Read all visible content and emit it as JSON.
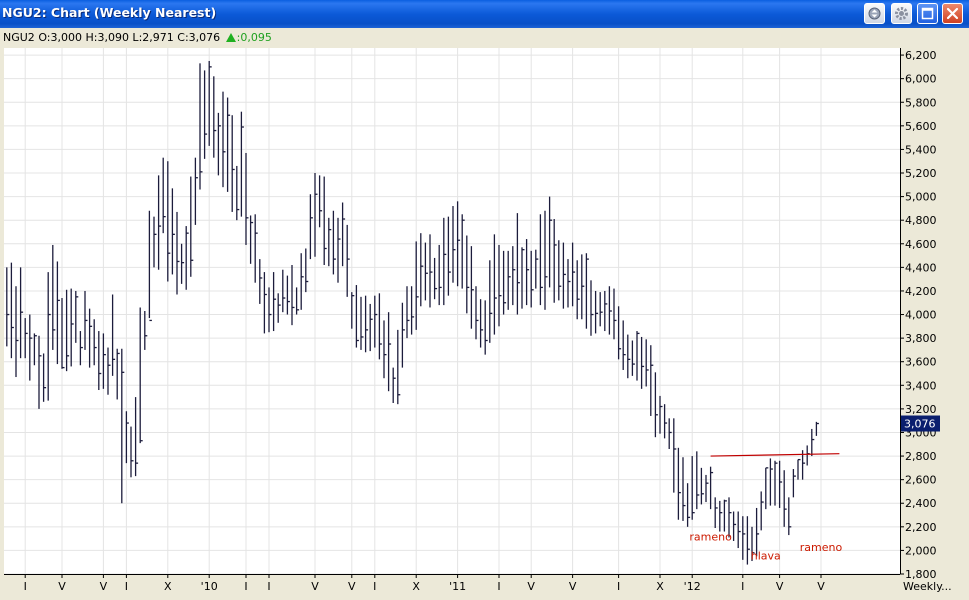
{
  "window": {
    "title": "NGU2: Chart (Weekly Nearest)",
    "buttons": [
      "scroll-icon",
      "gear-icon",
      "maximize-icon",
      "close-icon"
    ]
  },
  "quote": {
    "symbol": "NGU2",
    "ohlc": "O:3,000 H:3,090 L:2,971 C:3,076",
    "change": ":0,095",
    "change_color": "#20a020"
  },
  "colors": {
    "bars": "#1c1c3c",
    "neckline": "#c00000",
    "annotation": "#cc1a00",
    "last_price_bg": "#0a1e6e",
    "grid": "#e4e4e4"
  },
  "chart_data": {
    "type": "ohlc",
    "ylim": [
      1800,
      6260
    ],
    "y_ticks": [
      "6,200",
      "6,000",
      "5,800",
      "5,600",
      "5,400",
      "5,200",
      "5,000",
      "4,800",
      "4,600",
      "4,400",
      "4,200",
      "4,000",
      "3,800",
      "3,600",
      "3,400",
      "3,200",
      "3,000",
      "2,800",
      "2,600",
      "2,400",
      "2,200",
      "2,000",
      "1,800"
    ],
    "x_ticks": [
      "I",
      "V",
      "V",
      "I",
      "X",
      "'10",
      "I",
      "I",
      "V",
      "V",
      "I",
      "X",
      "'11",
      "I",
      "V",
      "V",
      "I",
      "X",
      "'12",
      "I",
      "V",
      "V"
    ],
    "x_tick_index": [
      4,
      12,
      21,
      26,
      35,
      44,
      52,
      57,
      67,
      75,
      80,
      89,
      98,
      107,
      114,
      123,
      133,
      142,
      149,
      160,
      168,
      177
    ],
    "period_label": "Weekly...",
    "last_price": "3,076",
    "last_value": 3076,
    "neckline": {
      "from_index": 153,
      "to_index": 181,
      "value_start": 2800,
      "value_end": 2820
    },
    "annotations": [
      {
        "text": "rameno",
        "index": 153,
        "value": 2085
      },
      {
        "text": "hlava",
        "index": 165,
        "value": 1925
      },
      {
        "text": "rameno",
        "index": 177,
        "value": 1995
      }
    ],
    "series": [
      {
        "close": [
          4000,
          3890,
          3780,
          4020,
          3840,
          3800,
          3820,
          3650,
          3380,
          4000,
          3870,
          4120,
          3550,
          3650,
          3920,
          4150,
          3720,
          3950,
          3900,
          3720,
          3500,
          3660,
          3570,
          3620,
          3670,
          3510,
          3080,
          2760,
          2740,
          2930,
          3820,
          3950,
          4680,
          4750,
          4830,
          4520,
          4680,
          4450,
          4440,
          4690,
          4460,
          5160,
          5210,
          5530,
          6100,
          5560,
          5600,
          5380,
          5690,
          5230,
          4890,
          5590,
          4820,
          4780,
          4690,
          4310,
          4170,
          4000,
          4130,
          4080,
          4140,
          4110,
          4060,
          4040,
          4320,
          4280,
          4820,
          5020,
          4880,
          4560,
          4720,
          4470,
          4640,
          4810,
          4470,
          4160,
          3780,
          3810,
          3870,
          3960,
          4000,
          3750,
          3660,
          3750,
          3460,
          3320,
          3870,
          3950,
          3980,
          4150,
          4410,
          4350,
          4360,
          4220,
          4230,
          4510,
          4360,
          4550,
          4630,
          4800,
          4230,
          4210,
          3950,
          3870,
          3780,
          4010,
          4140,
          4160,
          4100,
          4320,
          4380,
          4270,
          4550,
          4380,
          4210,
          4470,
          4230,
          4320,
          4800,
          4590,
          4240,
          4340,
          4280,
          4360,
          4130,
          4240,
          4470,
          4000,
          4010,
          4020,
          4090,
          4030,
          3950,
          3710,
          3660,
          3620,
          3580,
          3840,
          3560,
          3530,
          3570,
          3150,
          3220,
          3080,
          3000,
          2860,
          2490,
          2380,
          2280,
          2320,
          2470,
          2480,
          2570,
          2660,
          2360,
          2320,
          2420,
          2320,
          2220,
          2160,
          2140,
          2010,
          1980,
          2140,
          2410,
          2700,
          2690,
          2740,
          2580,
          2350,
          2200,
          2630,
          2770,
          2740,
          2820,
          2940,
          3076
        ],
        "high": [
          4400,
          4440,
          4240,
          4400,
          3970,
          4000,
          3840,
          3820,
          3670,
          4360,
          4590,
          4450,
          4140,
          4210,
          4220,
          4200,
          3860,
          4200,
          4050,
          3960,
          3860,
          3840,
          3720,
          4170,
          3710,
          3710,
          3180,
          3050,
          3300,
          4060,
          4030,
          4880,
          4830,
          5180,
          5330,
          5300,
          5070,
          4870,
          4600,
          4750,
          5170,
          5330,
          6130,
          6070,
          6150,
          6020,
          5710,
          5890,
          5840,
          5690,
          5260,
          5720,
          5370,
          4840,
          4850,
          4470,
          4360,
          4230,
          4360,
          4180,
          4380,
          4330,
          4420,
          4230,
          4520,
          4560,
          5020,
          5200,
          5180,
          5170,
          4820,
          4880,
          4820,
          4950,
          4760,
          4190,
          4250,
          4150,
          4160,
          4090,
          4160,
          4180,
          3950,
          4020,
          3550,
          3870,
          4100,
          4240,
          4240,
          4620,
          4690,
          4610,
          4680,
          4480,
          4590,
          4820,
          4830,
          4920,
          4960,
          4850,
          4670,
          4580,
          4240,
          4130,
          4120,
          4460,
          4680,
          4590,
          4540,
          4540,
          4580,
          4860,
          4570,
          4640,
          4540,
          4550,
          4850,
          4880,
          5000,
          4810,
          4630,
          4610,
          4470,
          4610,
          4460,
          4510,
          4520,
          4290,
          4200,
          4190,
          4200,
          4240,
          4220,
          4070,
          3950,
          3830,
          3780,
          3860,
          3810,
          3790,
          3740,
          3510,
          3310,
          3240,
          3120,
          3120,
          2870,
          2790,
          2570,
          2800,
          2840,
          2700,
          2640,
          2710,
          2450,
          2420,
          2430,
          2450,
          2330,
          2330,
          2290,
          2290,
          2200,
          2360,
          2500,
          2700,
          2780,
          2760,
          2760,
          2680,
          2450,
          2690,
          2770,
          2850,
          2890,
          3030,
          3090
        ],
        "low": [
          3730,
          3630,
          3470,
          3630,
          3630,
          3440,
          3570,
          3200,
          3260,
          3270,
          3700,
          3580,
          3540,
          3520,
          3560,
          3760,
          3570,
          3700,
          3550,
          3570,
          3360,
          3370,
          3320,
          3480,
          3280,
          2400,
          2740,
          2620,
          2630,
          2910,
          3700,
          3970,
          4400,
          4380,
          4690,
          4280,
          4340,
          4170,
          4260,
          4210,
          4320,
          4760,
          5060,
          5320,
          5430,
          5330,
          5180,
          5080,
          5040,
          4870,
          4800,
          4830,
          4590,
          4430,
          4270,
          4090,
          3840,
          3850,
          3860,
          3930,
          4020,
          4000,
          3910,
          4000,
          4040,
          4190,
          4470,
          4490,
          4740,
          4420,
          4410,
          4340,
          4270,
          4410,
          4150,
          3880,
          3720,
          3700,
          3680,
          3690,
          3720,
          3620,
          3460,
          3350,
          3250,
          3240,
          3550,
          3800,
          3830,
          3870,
          4070,
          4120,
          4060,
          4130,
          4080,
          4080,
          4160,
          4270,
          4240,
          4220,
          4010,
          3880,
          3790,
          3720,
          3660,
          3760,
          3830,
          3900,
          4000,
          4040,
          4080,
          4000,
          4050,
          4080,
          4060,
          4220,
          4080,
          4040,
          4230,
          4100,
          4120,
          4050,
          4060,
          4070,
          3960,
          3960,
          3880,
          3820,
          3840,
          3900,
          3860,
          3830,
          3790,
          3620,
          3530,
          3460,
          3480,
          3440,
          3370,
          3390,
          3140,
          2960,
          2990,
          2950,
          2860,
          2490,
          2260,
          2250,
          2200,
          2260,
          2350,
          2390,
          2410,
          2350,
          2190,
          2160,
          2160,
          2110,
          2080,
          2020,
          1920,
          1880,
          1910,
          1950,
          2170,
          2350,
          2380,
          2380,
          2360,
          2200,
          2130,
          2450,
          2600,
          2600,
          2720,
          2800,
          2971
        ]
      }
    ]
  }
}
